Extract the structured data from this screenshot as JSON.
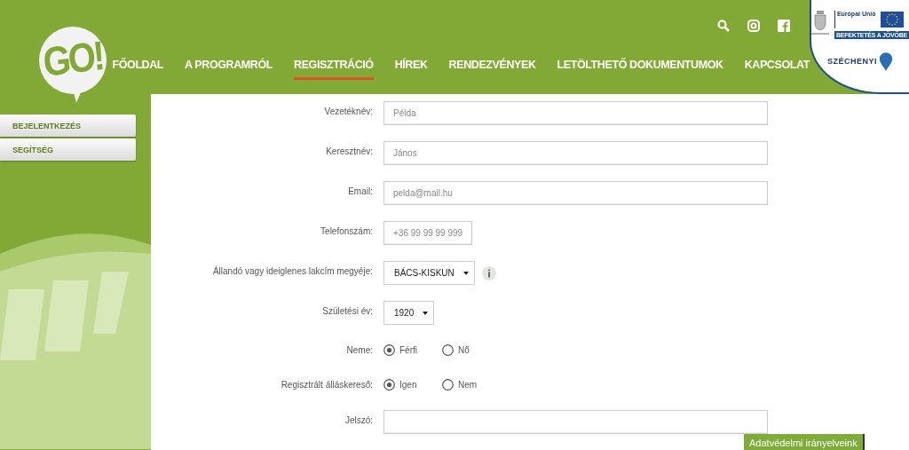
{
  "header": {
    "logo_text": "GO!",
    "nav": [
      {
        "label": "FŐOLDAL",
        "selected": false
      },
      {
        "label": "A PROGRAMRÓL",
        "selected": false
      },
      {
        "label": "REGISZTRÁCIÓ",
        "selected": true
      },
      {
        "label": "HÍREK",
        "selected": false
      },
      {
        "label": "RENDEZVÉNYEK",
        "selected": false
      },
      {
        "label": "LETÖLTHETŐ DOKUMENTUMOK",
        "selected": false
      },
      {
        "label": "KAPCSOLAT",
        "selected": false
      }
    ],
    "badge": {
      "eu_label": "Európai Unió",
      "slogan": "BEFEKTETÉS A JÖVŐBE",
      "program": "SZÉCHENYI"
    }
  },
  "sidebar": {
    "items": [
      {
        "label": "BEJELENTKEZÉS"
      },
      {
        "label": "SEGÍTSÉG"
      }
    ]
  },
  "form": {
    "fields": [
      {
        "kind": "text",
        "label": "Vezetéknév:",
        "placeholder": "Példa"
      },
      {
        "kind": "text",
        "label": "Keresztnév:",
        "placeholder": "János"
      },
      {
        "kind": "text",
        "label": "Email:",
        "placeholder": "pelda@mail.hu"
      },
      {
        "kind": "phone",
        "label": "Telefonszám:",
        "placeholder": "+36 99 99 99 999"
      },
      {
        "kind": "select",
        "label": "Állandó vagy ideiglenes lakcím megyéje:",
        "value": "BÁCS-KISKUN",
        "info": true
      },
      {
        "kind": "select",
        "label": "Születési év:",
        "value": "1920",
        "info": false
      },
      {
        "kind": "radio",
        "label": "Neme:",
        "options": [
          {
            "label": "Férfi",
            "selected": true
          },
          {
            "label": "Nő",
            "selected": false
          }
        ]
      },
      {
        "kind": "radio",
        "label": "Regisztrált álláskereső:",
        "options": [
          {
            "label": "Igen",
            "selected": true
          },
          {
            "label": "Nem",
            "selected": false
          }
        ]
      },
      {
        "kind": "password",
        "label": "Jelszó:"
      }
    ]
  },
  "privacy_button": "Adatvédelmi irányelveink"
}
